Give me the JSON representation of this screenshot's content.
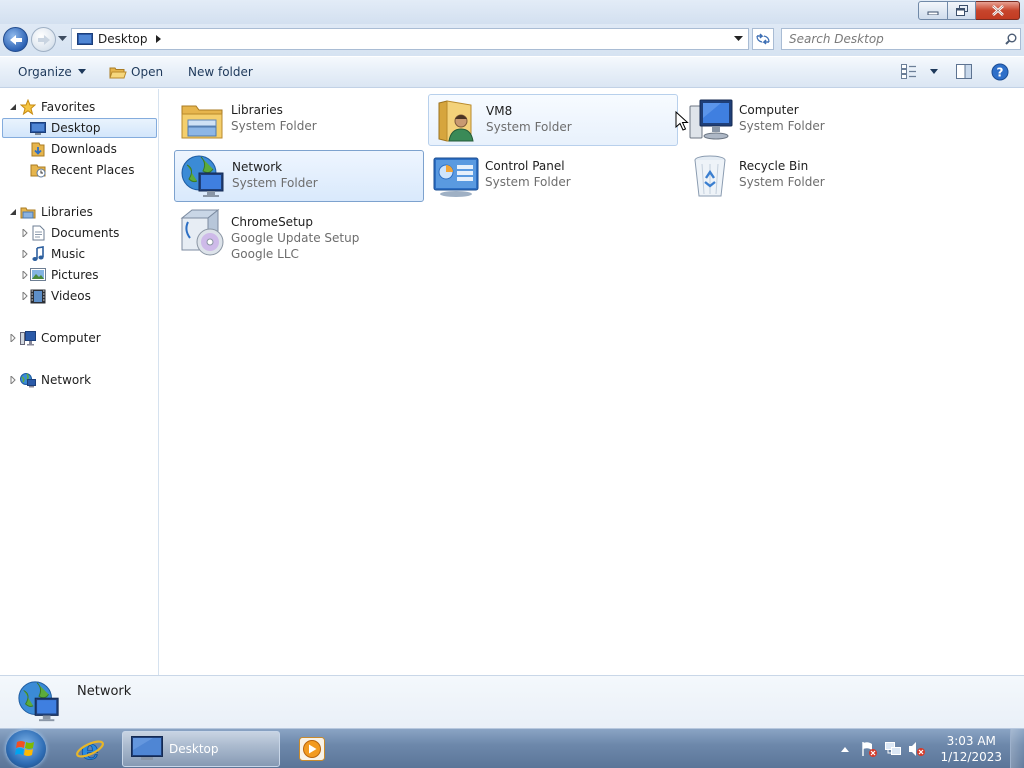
{
  "window": {
    "minimize_icon": "minimize-icon",
    "maximize_icon": "restore-icon",
    "close_icon": "close-icon"
  },
  "address_bar": {
    "location": "Desktop",
    "search_placeholder": "Search Desktop"
  },
  "toolbar": {
    "organize_label": "Organize",
    "open_label": "Open",
    "new_folder_label": "New folder"
  },
  "navigation": {
    "favorites": {
      "label": "Favorites",
      "items": [
        {
          "label": "Desktop",
          "selected": true
        },
        {
          "label": "Downloads"
        },
        {
          "label": "Recent Places"
        }
      ]
    },
    "libraries": {
      "label": "Libraries",
      "items": [
        {
          "label": "Documents"
        },
        {
          "label": "Music"
        },
        {
          "label": "Pictures"
        },
        {
          "label": "Videos"
        }
      ]
    },
    "computer": {
      "label": "Computer"
    },
    "network": {
      "label": "Network"
    }
  },
  "items": [
    {
      "name": "Libraries",
      "type": "System Folder"
    },
    {
      "name": "VM8",
      "type": "System Folder"
    },
    {
      "name": "Computer",
      "type": "System Folder"
    },
    {
      "name": "Network",
      "type": "System Folder",
      "selected": true
    },
    {
      "name": "Control Panel",
      "type": "System Folder"
    },
    {
      "name": "Recycle Bin",
      "type": "System Folder"
    },
    {
      "name": "ChromeSetup",
      "type": "Google Update Setup",
      "publisher": "Google LLC"
    }
  ],
  "details_pane": {
    "name": "Network"
  },
  "taskbar": {
    "active_task_label": "Desktop",
    "time": "3:03 AM",
    "date": "1/12/2023"
  },
  "colors": {
    "selection_border": "#7da2ce",
    "selection_fill": "#d9e9fc",
    "toolbar_text": "#1e395b",
    "secondary_text": "#6d6d6d"
  }
}
